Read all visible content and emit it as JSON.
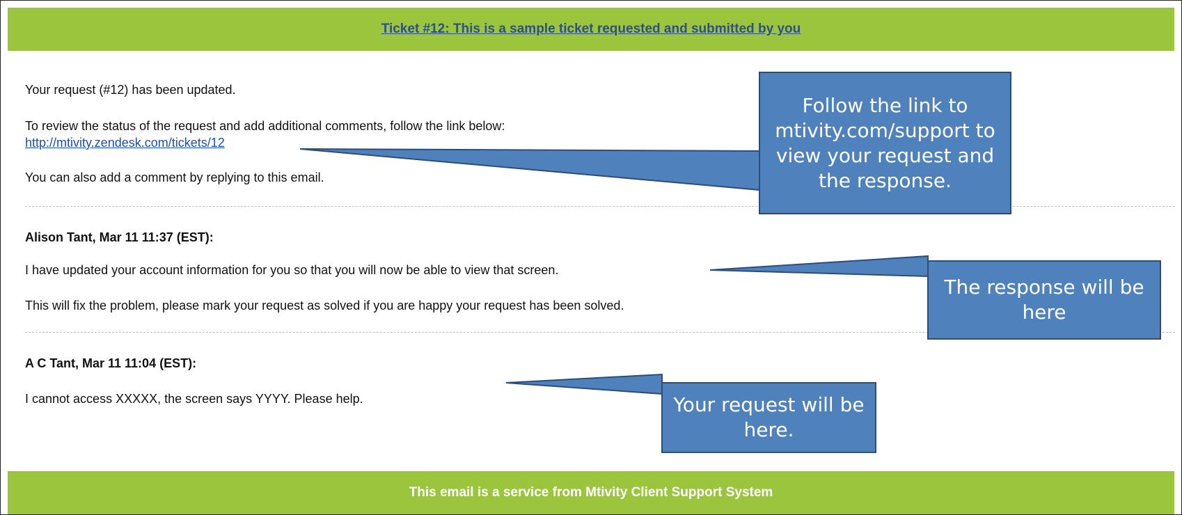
{
  "header": {
    "title": "Ticket #12: This is a sample ticket requested and submitted by you"
  },
  "intro": {
    "updated": "Your request (#12) has been updated.",
    "review": "To review the status of the request and add additional comments, follow the link below:",
    "link": "http://mtivity.zendesk.com/tickets/12",
    "reply": "You can also add a comment by replying to this email."
  },
  "comments": [
    {
      "author": "Alison Tant, Mar 11 11:37 (EST):",
      "lines": [
        "I have updated your account information for you so that you will now be able to view that screen.",
        "This will fix the problem, please mark your request as solved if you are happy your request has been solved."
      ]
    },
    {
      "author": "A C Tant, Mar 11 11:04 (EST):",
      "lines": [
        "I cannot access XXXXX, the screen says YYYY. Please help."
      ]
    }
  ],
  "callouts": {
    "link": "Follow the link to mtivity.com/support to view your request and the response.",
    "response": "The response will be here",
    "request": "Your request will be here."
  },
  "footer": {
    "text": "This email is a service from Mtivity Client Support System"
  },
  "colors": {
    "bar_green": "#9bc53c",
    "callout_blue": "#4f81bd",
    "link_blue": "#1a4fb8"
  }
}
